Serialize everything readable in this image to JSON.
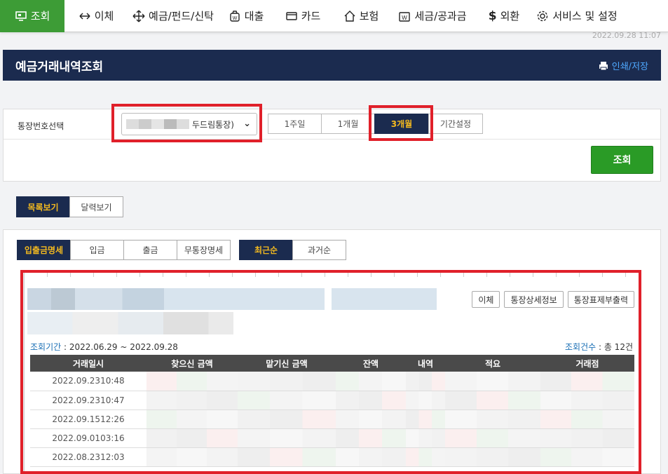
{
  "nav": {
    "items": [
      {
        "label": "조회",
        "icon": "monitor-icon"
      },
      {
        "label": "이체",
        "icon": "transfer-arrows-icon"
      },
      {
        "label": "예금/펀드/신탁",
        "icon": "move-arrows-icon"
      },
      {
        "label": "대출",
        "icon": "money-bag-icon"
      },
      {
        "label": "카드",
        "icon": "card-icon"
      },
      {
        "label": "보험",
        "icon": "house-icon"
      },
      {
        "label": "세금/공과금",
        "icon": "tax-bag-icon"
      },
      {
        "label": "외환",
        "icon": "dollar-icon"
      },
      {
        "label": "서비스 및 설정",
        "icon": "gear-icon"
      }
    ]
  },
  "datetime": "2022.09.28 11:07",
  "page": {
    "title": "예금거래내역조회",
    "print_label": "인쇄/저장"
  },
  "search": {
    "account_label": "통장번호선택",
    "account_value": "두드림통장)",
    "periods": [
      "1주일",
      "1개월",
      "3개월",
      "기간설정"
    ],
    "query_label": "조회"
  },
  "view_toggle": [
    "목록보기",
    "달력보기"
  ],
  "filters": [
    "입출금명세",
    "입금",
    "출금",
    "무통장명세"
  ],
  "sort": [
    "최근순",
    "과거순"
  ],
  "account_actions": [
    "이체",
    "통장상세정보",
    "통장표제부출력"
  ],
  "period_info": {
    "label": "조회기간",
    "value": " : 2022.06.29 ~ 2022.09.28"
  },
  "count_info": {
    "label": "조회건수",
    "value": " : 총 12건"
  },
  "table": {
    "headers": [
      "거래일시",
      "찾으신 금액",
      "맡기신 금액",
      "잔액",
      "내역",
      "적요",
      "거래점"
    ],
    "rows": [
      {
        "date": "2022.09.23",
        "time": "10:48"
      },
      {
        "date": "2022.09.23",
        "time": "10:47"
      },
      {
        "date": "2022.09.15",
        "time": "12:26"
      },
      {
        "date": "2022.09.01",
        "time": "03:16"
      },
      {
        "date": "2022.08.23",
        "time": "12:03"
      }
    ]
  },
  "colors": {
    "nav_active": "#3d9c36",
    "title_bar": "#1b2b4f",
    "active_tab_text": "#f3b91f",
    "highlight": "#e0202a",
    "query_button": "#2a9b26"
  }
}
